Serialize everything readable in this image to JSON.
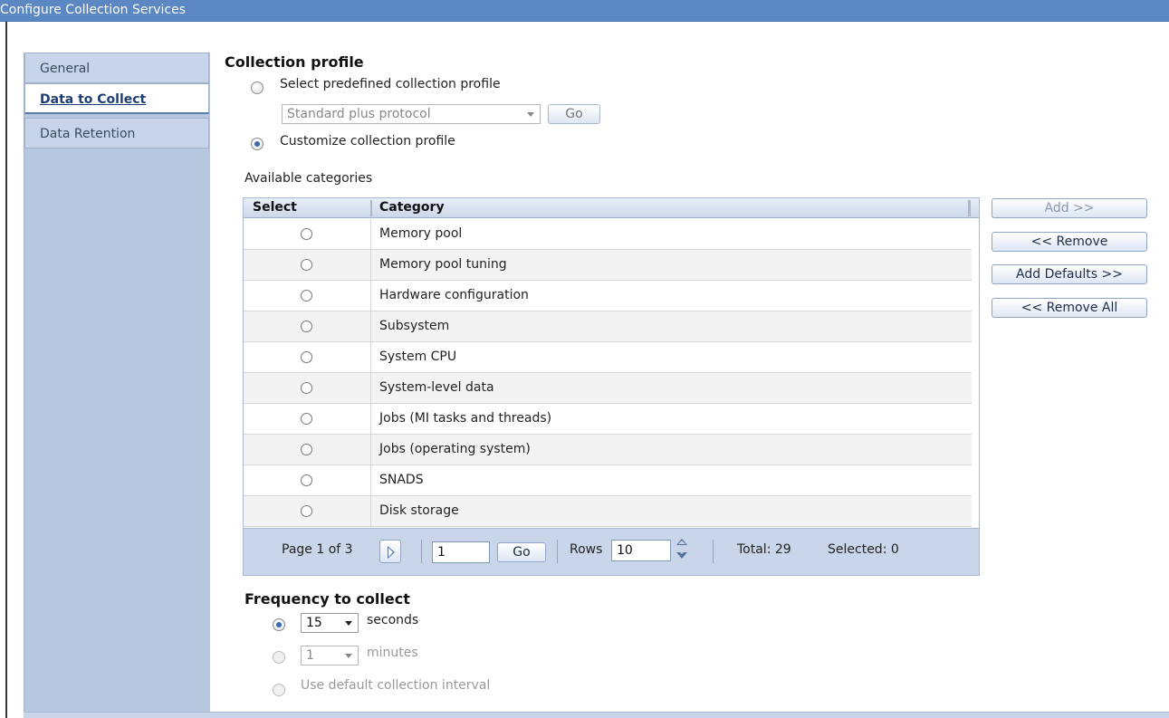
{
  "window": {
    "title": "Configure Collection Services"
  },
  "nav": {
    "items": [
      {
        "label": "General"
      },
      {
        "label": "Data to Collect"
      },
      {
        "label": "Data Retention"
      }
    ]
  },
  "collection_profile": {
    "heading": "Collection profile",
    "predefined_label": "Select predefined collection profile",
    "predefined_selected": false,
    "profile_select_value": "Standard plus protocol",
    "go_label": "Go",
    "customize_label": "Customize collection profile",
    "customize_selected": true
  },
  "available": {
    "label": "Available categories",
    "columns": [
      "Select",
      "Category"
    ],
    "rows": [
      "Memory pool",
      "Memory pool tuning",
      "Hardware configuration",
      "Subsystem",
      "System CPU",
      "System-level data",
      "Jobs (MI tasks and threads)",
      "Jobs (operating system)",
      "SNADS",
      "Disk storage"
    ]
  },
  "pager": {
    "page_text": "Page 1 of 3",
    "page_input": "1",
    "go_label": "Go",
    "rows_label": "Rows",
    "rows_value": "10",
    "total_text": "Total: 29",
    "selected_text": "Selected: 0"
  },
  "actions": {
    "add": "Add >>",
    "remove": "<< Remove",
    "add_defaults": "Add Defaults >>",
    "remove_all": "<< Remove All"
  },
  "frequency": {
    "heading": "Frequency to collect",
    "seconds_value": "15",
    "seconds_label": "seconds",
    "minutes_value": "1",
    "minutes_label": "minutes",
    "default_label": "Use default collection interval"
  },
  "icons": [
    "radio-icon",
    "dropdown-arrow-icon",
    "next-page-icon",
    "spinner-icon"
  ]
}
